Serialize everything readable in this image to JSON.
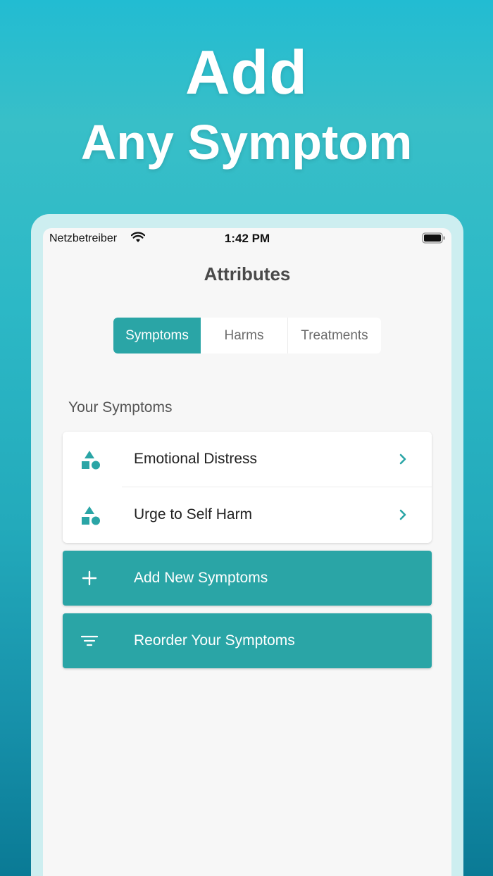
{
  "promo": {
    "line1": "Add",
    "line2": "Any Symptom"
  },
  "status_bar": {
    "carrier": "Netzbetreiber",
    "time": "1:42 PM"
  },
  "nav": {
    "title": "Attributes"
  },
  "segments": [
    {
      "label": "Symptoms",
      "selected": true
    },
    {
      "label": "Harms",
      "selected": false
    },
    {
      "label": "Treatments",
      "selected": false
    }
  ],
  "section": {
    "header": "Your Symptoms"
  },
  "symptoms": [
    {
      "label": "Emotional Distress",
      "icon": "shapes-icon"
    },
    {
      "label": "Urge to Self Harm",
      "icon": "shapes-icon"
    }
  ],
  "actions": {
    "add_label": "Add New Symptoms",
    "reorder_label": "Reorder Your Symptoms"
  },
  "colors": {
    "accent": "#2aa5a6",
    "background_top": "#22bcd2",
    "background_bottom": "#0a7a95"
  }
}
